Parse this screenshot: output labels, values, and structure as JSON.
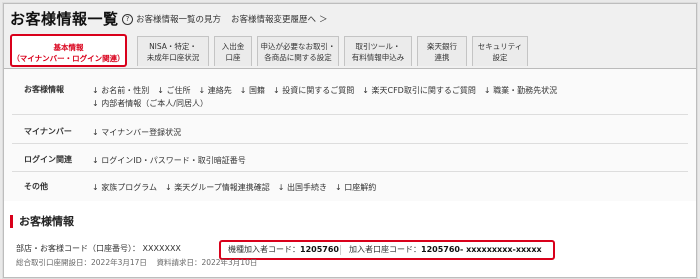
{
  "header": {
    "title": "お客様情報一覧",
    "help_link": "お客様情報一覧の見方",
    "history_link": "お客様情報変更履歴へ",
    "history_arrow": "＞"
  },
  "tabs": [
    {
      "line1": "基本情報",
      "line2": "（マイナンバー・ログイン関連）"
    },
    {
      "line1": "NISA・特定・",
      "line2": "未成年口座状況"
    },
    {
      "line1": "入出金",
      "line2": "口座"
    },
    {
      "line1": "申込が必要なお取引・",
      "line2": "各商品に関する設定"
    },
    {
      "line1": "取引ツール・",
      "line2": "有料情報申込み"
    },
    {
      "line1": "楽天銀行",
      "line2": "連携"
    },
    {
      "line1": "セキュリティ",
      "line2": "設定"
    }
  ],
  "rows": {
    "customer": {
      "label": "お客様情報",
      "links": [
        "お名前・性別",
        "ご住所",
        "連絡先",
        "国籍",
        "投資に関するご質問",
        "楽天CFD取引に関するご質問",
        "職業・勤務先状況",
        "内部者情報（ご本人/同居人）"
      ]
    },
    "mynumber": {
      "label": "マイナンバー",
      "links": [
        "マイナンバー登録状況"
      ]
    },
    "login": {
      "label": "ログイン関連",
      "links": [
        "ログインID・パスワード・取引暗証番号"
      ]
    },
    "other": {
      "label": "その他",
      "links": [
        "家族プログラム",
        "楽天グループ情報連携確認",
        "出国手続き",
        "口座解約"
      ]
    }
  },
  "section": {
    "title": "お客様情報",
    "branch_label": "部店・お客様コード（口座番号）：",
    "branch_value": "XXXXXXX",
    "member_code_label": "機種加入者コード：",
    "member_code_value": "1205760",
    "account_code_label": "加入者口座コード：",
    "account_code_value": "1205760- xxxxxxxxx-xxxxx",
    "open_date_label": "総合取引口座開設日：",
    "open_date_value": "2022年3月17日",
    "request_date_label": "資料請求日：",
    "request_date_value": "2022年3月10日"
  },
  "colors": {
    "accent": "#d9001b",
    "header_bg": "#f0f0f0"
  }
}
